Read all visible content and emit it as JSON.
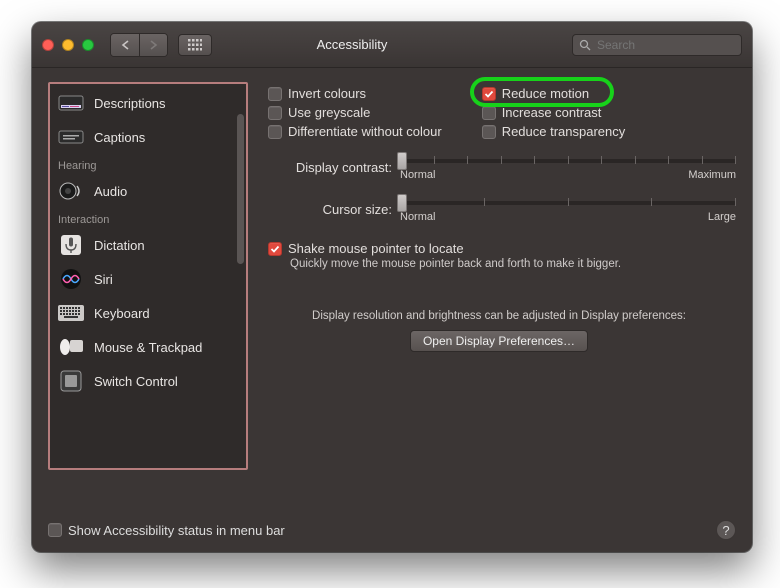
{
  "window": {
    "title": "Accessibility"
  },
  "search": {
    "placeholder": "Search"
  },
  "sidebar": {
    "items": [
      {
        "label": "Descriptions",
        "icon": "descriptions"
      },
      {
        "label": "Captions",
        "icon": "captions"
      }
    ],
    "hearing_label": "Hearing",
    "hearing": [
      {
        "label": "Audio",
        "icon": "audio"
      }
    ],
    "interaction_label": "Interaction",
    "interaction": [
      {
        "label": "Dictation",
        "icon": "mic"
      },
      {
        "label": "Siri",
        "icon": "siri"
      },
      {
        "label": "Keyboard",
        "icon": "keyboard"
      },
      {
        "label": "Mouse & Trackpad",
        "icon": "mouse"
      },
      {
        "label": "Switch Control",
        "icon": "switch"
      }
    ]
  },
  "options": {
    "left": {
      "invert": "Invert colours",
      "greyscale": "Use greyscale",
      "differentiate": "Differentiate without colour"
    },
    "right": {
      "reduce_motion": "Reduce motion",
      "increase_contrast": "Increase contrast",
      "reduce_transparency": "Reduce transparency"
    }
  },
  "sliders": {
    "contrast": {
      "label": "Display contrast:",
      "min_label": "Normal",
      "max_label": "Maximum"
    },
    "cursor": {
      "label": "Cursor size:",
      "min_label": "Normal",
      "max_label": "Large"
    }
  },
  "shake": {
    "label": "Shake mouse pointer to locate",
    "hint": "Quickly move the mouse pointer back and forth to make it bigger."
  },
  "display_pref": {
    "note": "Display resolution and brightness can be adjusted in Display preferences:",
    "button": "Open Display Preferences…"
  },
  "footer": {
    "show_status": "Show Accessibility status in menu bar"
  }
}
